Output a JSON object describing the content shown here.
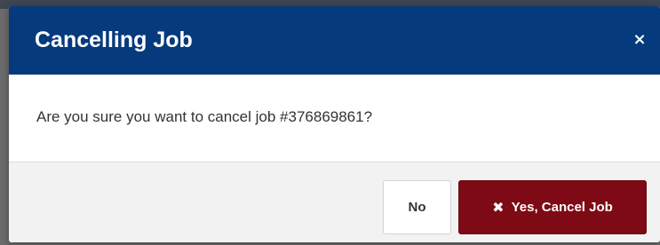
{
  "modal": {
    "title": "Cancelling Job",
    "close_glyph": "×",
    "close_icon": "close-icon",
    "message": "Are you sure you want to cancel job #376869861?",
    "buttons": {
      "no_label": "No",
      "yes_label": "Yes, Cancel Job",
      "yes_icon": "x-mark-icon",
      "yes_icon_glyph": "✖"
    }
  },
  "colors": {
    "header_bg": "#053a7d",
    "danger": "#7d0a14",
    "footer_bg": "#f2f2f2"
  }
}
